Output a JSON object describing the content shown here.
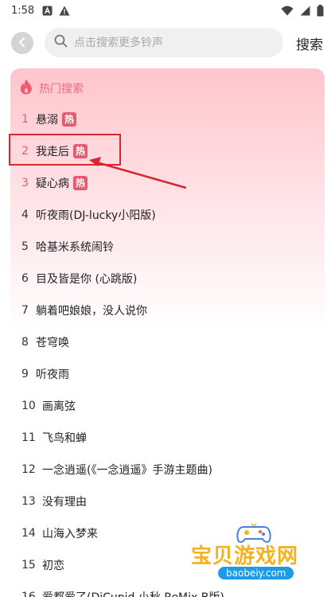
{
  "status_bar": {
    "time": "1:58",
    "left_icons": [
      "a-notification-icon",
      "warning-icon"
    ],
    "right_icons": [
      "wifi-icon",
      "signal-icon",
      "battery-icon"
    ]
  },
  "search": {
    "placeholder": "点击搜索更多铃声",
    "button_label": "搜索"
  },
  "hot": {
    "title": "热门搜索",
    "badge_label": "热",
    "accent_color": "#e8596f",
    "items": [
      {
        "rank": "1",
        "title": "悬溺",
        "hot": true
      },
      {
        "rank": "2",
        "title": "我走后",
        "hot": true
      },
      {
        "rank": "3",
        "title": "疑心病",
        "hot": true
      },
      {
        "rank": "4",
        "title": "听夜雨(DJ-lucky小阳版)",
        "hot": false
      },
      {
        "rank": "5",
        "title": "哈基米系统闹铃",
        "hot": false
      },
      {
        "rank": "6",
        "title": "目及皆是你 (心跳版)",
        "hot": false
      },
      {
        "rank": "7",
        "title": "躺着吧娘娘，没人说你",
        "hot": false
      },
      {
        "rank": "8",
        "title": "苍穹唤",
        "hot": false
      },
      {
        "rank": "9",
        "title": "听夜雨",
        "hot": false
      },
      {
        "rank": "10",
        "title": "画离弦",
        "hot": false
      },
      {
        "rank": "11",
        "title": "飞鸟和蝉",
        "hot": false
      },
      {
        "rank": "12",
        "title": "一念逍遥(《一念逍遥》手游主题曲)",
        "hot": false
      },
      {
        "rank": "13",
        "title": "没有理由",
        "hot": false
      },
      {
        "rank": "14",
        "title": "山海入梦来",
        "hot": false
      },
      {
        "rank": "15",
        "title": "初恋",
        "hot": false
      },
      {
        "rank": "16",
        "title": "爱都爱了(DjCupid.小秋 ReMix B版)",
        "hot": false
      }
    ]
  },
  "watermark": {
    "brand": "宝贝游戏网",
    "url": "baobeiy.com"
  }
}
